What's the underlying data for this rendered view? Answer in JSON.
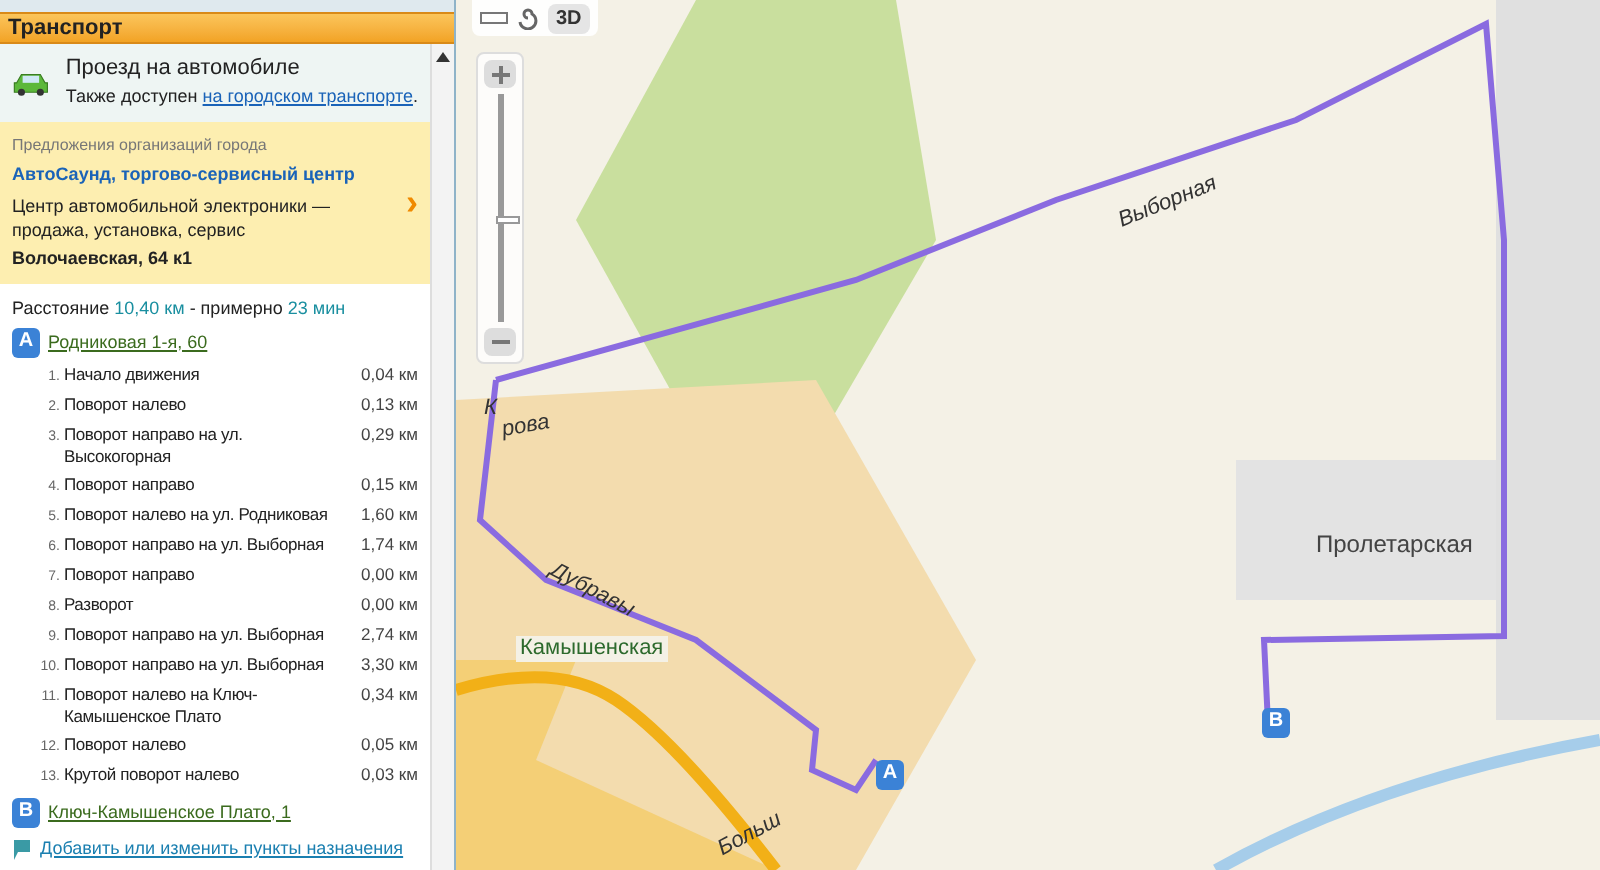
{
  "panel": {
    "title": "Транспорт",
    "mode": {
      "title": "Проезд на автомобиле",
      "note": "Также доступен",
      "link": "на городском транспорте",
      "tail": "."
    },
    "offer": {
      "heading": "Предложения организаций города",
      "name": "АвтоСаунд, торгово-сервисный центр",
      "description": "Центр автомобильной электроники — продажа, установка, сервис",
      "address": "Волочаевская, 64 к1",
      "arrow": "›"
    },
    "summary": {
      "label": "Расстояние",
      "distance": "10,40 км",
      "dash": "- примерно",
      "time": "23 мин"
    },
    "start": {
      "marker": "A",
      "address": "Родниковая 1-я, 60"
    },
    "steps": [
      {
        "n": "1.",
        "text": "Начало движения",
        "dist": "0,04 км"
      },
      {
        "n": "2.",
        "text": "Поворот налево",
        "dist": "0,13 км"
      },
      {
        "n": "3.",
        "text": "Поворот направо на ул. Высокогорная",
        "dist": "0,29 км"
      },
      {
        "n": "4.",
        "text": "Поворот направо",
        "dist": "0,15 км"
      },
      {
        "n": "5.",
        "text": "Поворот налево на ул. Родниковая",
        "dist": "1,60 км"
      },
      {
        "n": "6.",
        "text": "Поворот направо на ул. Выборная",
        "dist": "1,74 км"
      },
      {
        "n": "7.",
        "text": "Поворот направо",
        "dist": "0,00 км"
      },
      {
        "n": "8.",
        "text": "Разворот",
        "dist": "0,00 км"
      },
      {
        "n": "9.",
        "text": "Поворот направо на ул. Выборная",
        "dist": "2,74 км"
      },
      {
        "n": "10.",
        "text": "Поворот направо на ул. Выборная",
        "dist": "3,30 км"
      },
      {
        "n": "11.",
        "text": "Поворот налево на Ключ-Камышенское Плато",
        "dist": "0,34 км"
      },
      {
        "n": "12.",
        "text": "Поворот налево",
        "dist": "0,05 км"
      },
      {
        "n": "13.",
        "text": "Крутой поворот налево",
        "dist": "0,03 км"
      }
    ],
    "end": {
      "marker": "B",
      "address": "Ключ-Камышенское Плато, 1"
    },
    "edit_link": "Добавить или изменить пункты назначения"
  },
  "map": {
    "toolbar": {
      "button_3d": "3D"
    },
    "zoom": {
      "level": 0.45
    },
    "labels": [
      {
        "text": "Выборная",
        "kind": "street"
      },
      {
        "text": "К",
        "kind": "street"
      },
      {
        "text": "рова",
        "kind": "street"
      },
      {
        "text": "Пролетарская",
        "kind": "district"
      },
      {
        "text": "Дубравы",
        "kind": "street"
      },
      {
        "text": "Камышенская",
        "kind": "stop"
      },
      {
        "text": "Больш",
        "kind": "street"
      }
    ],
    "markers": [
      {
        "label": "A"
      },
      {
        "label": "B"
      }
    ]
  }
}
